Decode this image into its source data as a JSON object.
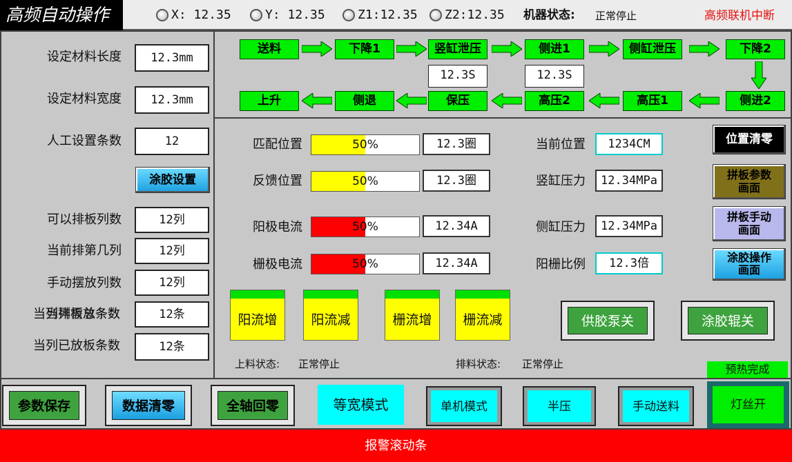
{
  "header": {
    "title": "高频自动操作",
    "axes": [
      {
        "label": "X:",
        "value": "12.35"
      },
      {
        "label": "Y:",
        "value": "12.35"
      },
      {
        "label": "Z1:",
        "value": "12.35"
      },
      {
        "label": "Z2:",
        "value": "12.35"
      }
    ],
    "machine_status_label": "机器状态:",
    "machine_status_value": "正常停止",
    "link_status": "高频联机中断"
  },
  "left_panel": {
    "material_length_label": "设定材料长度",
    "material_length_value": "12.3mm",
    "material_width_label": "设定材料宽度",
    "material_width_value": "12.3mm",
    "manual_count_label": "人工设置条数",
    "manual_count_value": "12",
    "glue_setting_button": "涂胶设置",
    "possible_columns_label": "可以排板列数",
    "possible_columns_value": "12列",
    "current_column_label": "当前排第几列",
    "current_column_value": "12列",
    "manual_columns_label": "手动摆放列数",
    "manual_columns_value": "12列",
    "overlap_label_a": "当列排板总条数",
    "overlap_label_b": "当列需放条数",
    "current_count_value": "12条",
    "placed_label": "当列已放板条数",
    "placed_value": "12条"
  },
  "process_flow": {
    "top_row": [
      "送料",
      "下降1",
      "竖缸泄压",
      "侧进1",
      "侧缸泄压",
      "下降2"
    ],
    "bottom_row": [
      "上升",
      "侧退",
      "保压",
      "高压2",
      "高压1",
      "侧进2"
    ],
    "timer_1": "12.3S",
    "timer_2": "12.3S"
  },
  "gauges": [
    {
      "label": "匹配位置",
      "percent": 50,
      "percent_text": "50%",
      "color": "#ffff00",
      "value": "12.3圈"
    },
    {
      "label": "反馈位置",
      "percent": 50,
      "percent_text": "50%",
      "color": "#ffff00",
      "value": "12.3圈"
    },
    {
      "label": "阳极电流",
      "percent": 50,
      "percent_text": "50%",
      "color": "#ff0000",
      "value": "12.34A"
    },
    {
      "label": "栅极电流",
      "percent": 50,
      "percent_text": "50%",
      "color": "#ff0000",
      "value": "12.34A"
    }
  ],
  "readings": {
    "current_position_label": "当前位置",
    "current_position_value": "1234CM",
    "vertical_pressure_label": "竖缸压力",
    "vertical_pressure_value": "12.34MPa",
    "side_pressure_label": "侧缸压力",
    "side_pressure_value": "12.34MPa",
    "ratio_label": "阳栅比例",
    "ratio_value": "12.3倍"
  },
  "side_buttons": {
    "position_reset": "位置清零",
    "board_params": "拼板参数画面",
    "board_manual": "拼板手动画面",
    "glue_operation": "涂胶操作画面"
  },
  "current_buttons": [
    "阳流增",
    "阳流减",
    "栅流增",
    "栅流减"
  ],
  "pump_buttons": {
    "glue_pump": "供胶泵关",
    "glue_roller": "涂胶辊关"
  },
  "status_lines": {
    "feed_label": "上料状态:",
    "feed_value": "正常停止",
    "discharge_label": "排料状态:",
    "discharge_value": "正常停止"
  },
  "preheat": "预热完成",
  "bottom_bar": {
    "save_params": "参数保存",
    "clear_data": "数据清零",
    "home_all": "全轴回零",
    "equal_width": "等宽模式",
    "single_mode": "单机模式",
    "half_pressure": "半压",
    "manual_feed": "手动送料",
    "filament_on": "灯丝开"
  },
  "alarm_bar": "报警滚动条",
  "colors": {
    "flow_green": "#00ee00",
    "gauge_yellow": "#ffff00",
    "gauge_red": "#ff0000",
    "alarm_red": "#ff0000",
    "cyan": "#00ffff",
    "link_red": "#e81010"
  }
}
